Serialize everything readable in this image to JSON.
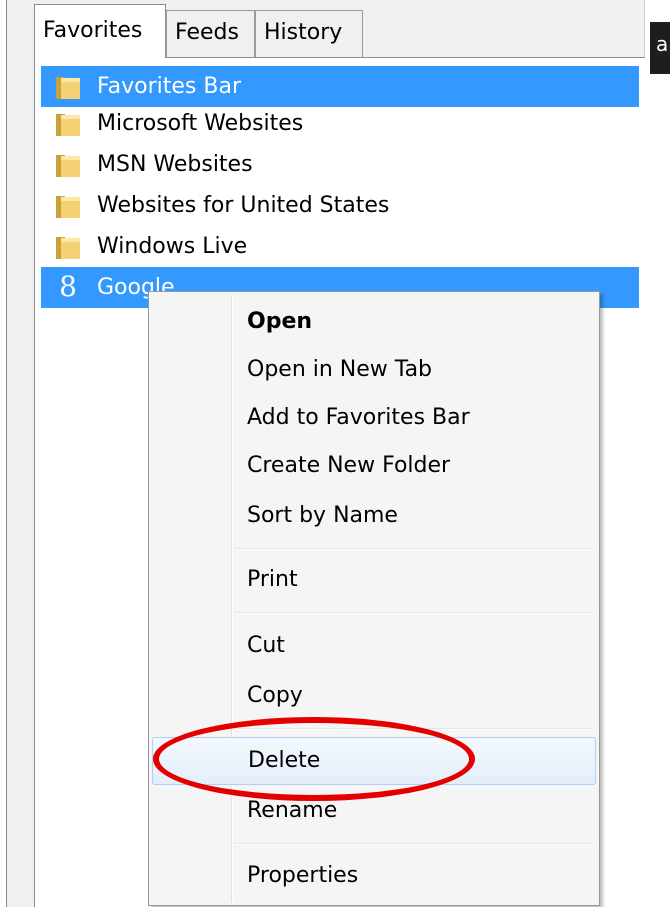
{
  "tabs": [
    {
      "label": "Favorites",
      "active": true
    },
    {
      "label": "Feeds",
      "active": false
    },
    {
      "label": "History",
      "active": false
    }
  ],
  "tree": {
    "items": [
      {
        "label": "Favorites Bar",
        "icon": "folder-icon",
        "selected": true
      },
      {
        "label": "Microsoft Websites",
        "icon": "folder-icon",
        "selected": false
      },
      {
        "label": "MSN Websites",
        "icon": "folder-icon",
        "selected": false
      },
      {
        "label": "Websites for United States",
        "icon": "folder-icon",
        "selected": false
      },
      {
        "label": "Windows Live",
        "icon": "folder-icon",
        "selected": false
      },
      {
        "label": "Google",
        "icon": "google-g-icon",
        "glyph": "8",
        "selected": true
      }
    ]
  },
  "context_menu": {
    "items": [
      {
        "label": "Open",
        "bold": true
      },
      {
        "label": "Open in New Tab"
      },
      {
        "label": "Add to Favorites Bar"
      },
      {
        "label": "Create New Folder"
      },
      {
        "label": "Sort by Name"
      },
      {
        "label": "Print"
      },
      {
        "label": "Cut"
      },
      {
        "label": "Copy"
      },
      {
        "label": "Delete",
        "hovered": true,
        "circled": true
      },
      {
        "label": "Rename"
      },
      {
        "label": "Properties"
      }
    ]
  },
  "edge_text": "a",
  "colors": {
    "selection": "#3399ff",
    "highlight_ring": "#e50000",
    "menu_background": "#f5f5f5"
  }
}
